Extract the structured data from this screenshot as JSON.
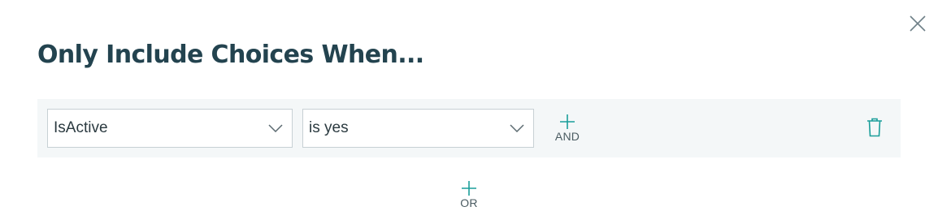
{
  "dialog": {
    "title": "Only Include Choices When..."
  },
  "rule": {
    "field": {
      "value": "IsActive"
    },
    "operator": {
      "value": "is yes"
    },
    "add_and_label": "AND"
  },
  "add_or_label": "OR",
  "icons": {
    "close": "close-icon",
    "chevron": "chevron-down-icon",
    "plus": "plus-icon",
    "delete": "trash-icon"
  },
  "colors": {
    "title": "#23434f",
    "accent": "#1a9e9a",
    "row_background": "#f4f7f8",
    "border": "#c7d0d4"
  }
}
